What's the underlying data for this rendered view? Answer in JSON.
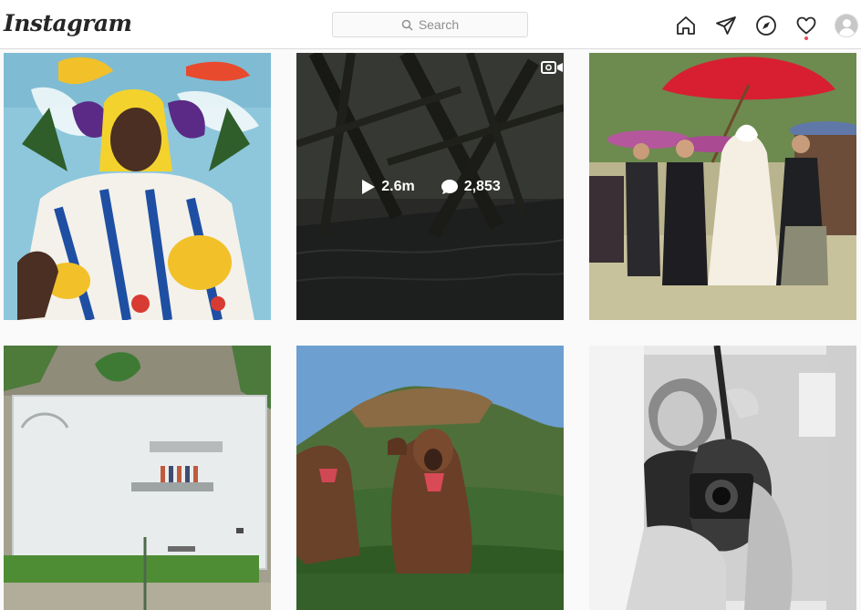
{
  "header": {
    "logo": "Instagram",
    "search_placeholder": "Search",
    "icons": [
      "home-icon",
      "direct-icon",
      "explore-icon",
      "activity-icon",
      "profile-avatar"
    ],
    "notification_dot_color": "#ed4956"
  },
  "posts": [
    {
      "description": "portrait of woman in colorful patterned dress before painted mural"
    },
    {
      "description": "dark swamp with tangled trees",
      "type": "video",
      "views": "2.6m",
      "comments": "2,853"
    },
    {
      "description": "traditional Japanese wedding procession with red umbrella"
    },
    {
      "description": "aerial view of empty skate pool with people"
    },
    {
      "description": "gelada monkeys on grassy hill"
    },
    {
      "description": "black and white mirror selfie with girl and camera"
    }
  ]
}
